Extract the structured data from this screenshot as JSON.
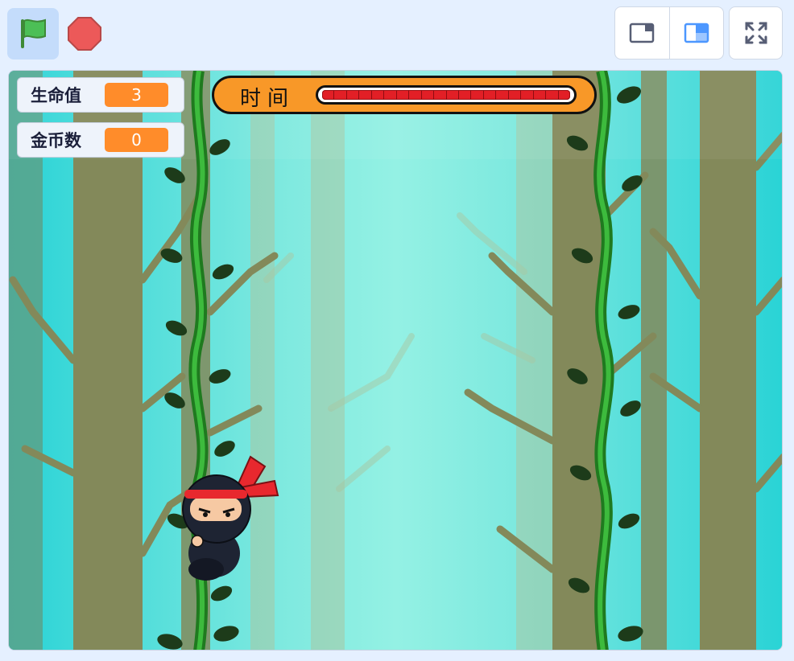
{
  "toolbar": {
    "green_flag_icon": "green-flag-icon",
    "stop_icon": "stop-icon",
    "layout_modes": [
      "small-stage-icon",
      "normal-stage-icon"
    ],
    "fullscreen_icon": "fullscreen-icon",
    "colors": {
      "flag_bg": "#c4dcfb",
      "flag": "#45993d",
      "stop": "#ec5959",
      "active_mode": "#4c97ff"
    }
  },
  "stage": {
    "monitors": [
      {
        "label": "生命值",
        "value": "3"
      },
      {
        "label": "金币数",
        "value": "0"
      }
    ],
    "timer": {
      "label": "时间",
      "progress": 1.0,
      "segments": 20
    },
    "colors": {
      "sky": "#29d3d6",
      "light": "#8ef0e2",
      "trunk": "#83895a",
      "monitor_value": "#ff8c2a",
      "timer_bg": "#f89828",
      "timer_bar": "#e21f26"
    },
    "sprites": [
      "ninja-sprite",
      "vine-left",
      "vine-right"
    ]
  }
}
